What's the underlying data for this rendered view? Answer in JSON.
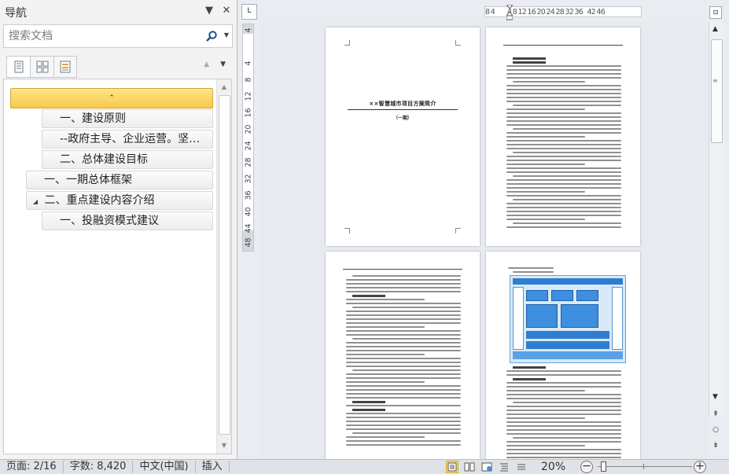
{
  "nav": {
    "title": "导航",
    "search_placeholder": "搜索文档",
    "tree": [
      {
        "label": "⌃",
        "selected": true
      },
      {
        "label": "一、建设原则"
      },
      {
        "label": "--政府主导、企业运营。坚…"
      },
      {
        "label": "二、总体建设目标"
      },
      {
        "label": "一、一期总体框架"
      },
      {
        "label": "二、重点建设内容介绍",
        "expander": "◢"
      },
      {
        "label": "一、投融资模式建议"
      }
    ]
  },
  "ruler": {
    "corner": "L",
    "h_ticks": [
      "8",
      "4",
      "4",
      "8",
      "12",
      "16",
      "20",
      "24",
      "28",
      "32",
      "36",
      "42",
      "46"
    ],
    "v_ticks": [
      "4",
      "4",
      "8",
      "12",
      "16",
      "20",
      "24",
      "28",
      "32",
      "36",
      "40",
      "44",
      "48"
    ]
  },
  "pages": {
    "cover_title": "××智慧城市项目方案简介",
    "cover_sub": "（一期）"
  },
  "status": {
    "page": "页面: 2/16",
    "words": "字数: 8,420",
    "language": "中文(中国)",
    "mode": "插入",
    "zoom": "20%"
  }
}
